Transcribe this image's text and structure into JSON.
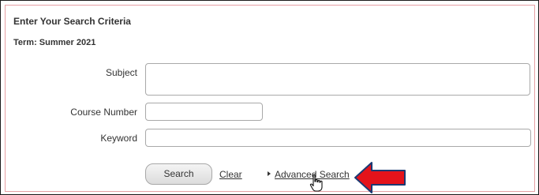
{
  "panel": {
    "title": "Enter Your Search Criteria",
    "term": "Term: Summer 2021"
  },
  "form": {
    "subject_label": "Subject",
    "subject_value": "",
    "course_number_label": "Course Number",
    "course_number_value": "",
    "keyword_label": "Keyword",
    "keyword_value": ""
  },
  "actions": {
    "search_label": "Search",
    "clear_label": "Clear",
    "advanced_search_label": "Advanced Search"
  },
  "icons": {
    "expand": "triangle-right-icon",
    "annotation_arrow": "red-arrow-left-icon",
    "cursor": "hand-pointer-cursor-icon"
  },
  "colors": {
    "panel_border": "#e6a0a4",
    "annotation_arrow_fill": "#e4131b",
    "annotation_arrow_stroke": "#1b3a73"
  }
}
